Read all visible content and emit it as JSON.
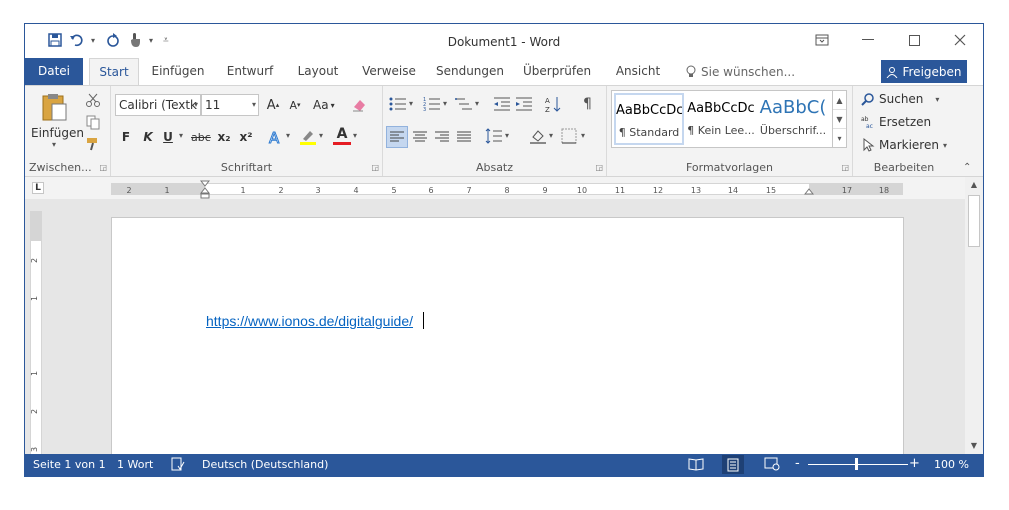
{
  "window": {
    "title": "Dokument1 - Word"
  },
  "qat": {
    "save": "save-icon",
    "undo": "undo-icon",
    "redo": "redo-icon",
    "touch": "touch-mode-icon"
  },
  "tabs": [
    {
      "label": "Datei"
    },
    {
      "label": "Start"
    },
    {
      "label": "Einfügen"
    },
    {
      "label": "Entwurf"
    },
    {
      "label": "Layout"
    },
    {
      "label": "Verweise"
    },
    {
      "label": "Sendungen"
    },
    {
      "label": "Überprüfen"
    },
    {
      "label": "Ansicht"
    }
  ],
  "tell_me": "Sie wünschen...",
  "share_label": "Freigeben",
  "clipboard": {
    "paste_label": "Einfügen",
    "group_label": "Zwischen..."
  },
  "font": {
    "name": "Calibri (Textk",
    "size": "11",
    "case": "Aa",
    "bold": "F",
    "italic": "K",
    "underline": "U",
    "strike": "abc",
    "sub": "x₂",
    "sup": "x²",
    "color_letter": "A",
    "group_label": "Schriftart"
  },
  "paragraph": {
    "group_label": "Absatz",
    "pilcrow": "¶"
  },
  "styles": {
    "items": [
      {
        "preview": "AaBbCcDc",
        "name": "¶ Standard"
      },
      {
        "preview": "AaBbCcDc",
        "name": "¶ Kein Lee..."
      },
      {
        "preview": "AaBbC(",
        "name": "Überschrif..."
      }
    ],
    "group_label": "Formatvorlagen"
  },
  "editing": {
    "find": "Suchen",
    "replace": "Ersetzen",
    "select": "Markieren",
    "group_label": "Bearbeiten"
  },
  "ruler": {
    "h_ticks": [
      "2",
      "1",
      "1",
      "2",
      "3",
      "4",
      "5",
      "6",
      "7",
      "8",
      "9",
      "10",
      "11",
      "12",
      "13",
      "14",
      "15",
      "17",
      "18"
    ],
    "v_ticks": [
      "2",
      "1",
      "1",
      "2",
      "3"
    ],
    "tab_selector": "L"
  },
  "document": {
    "text": "https://www.ionos.de/digitalguide/"
  },
  "status": {
    "page": "Seite 1 von 1",
    "words": "1 Wort",
    "language": "Deutsch (Deutschland)",
    "zoom": "100 %",
    "minus": "-",
    "plus": "+"
  },
  "colors": {
    "brand": "#2b579a",
    "ribbon": "#f3f3f3",
    "link": "#0563c1",
    "highlight": "#ffff00",
    "font_color": "#e51c23"
  }
}
